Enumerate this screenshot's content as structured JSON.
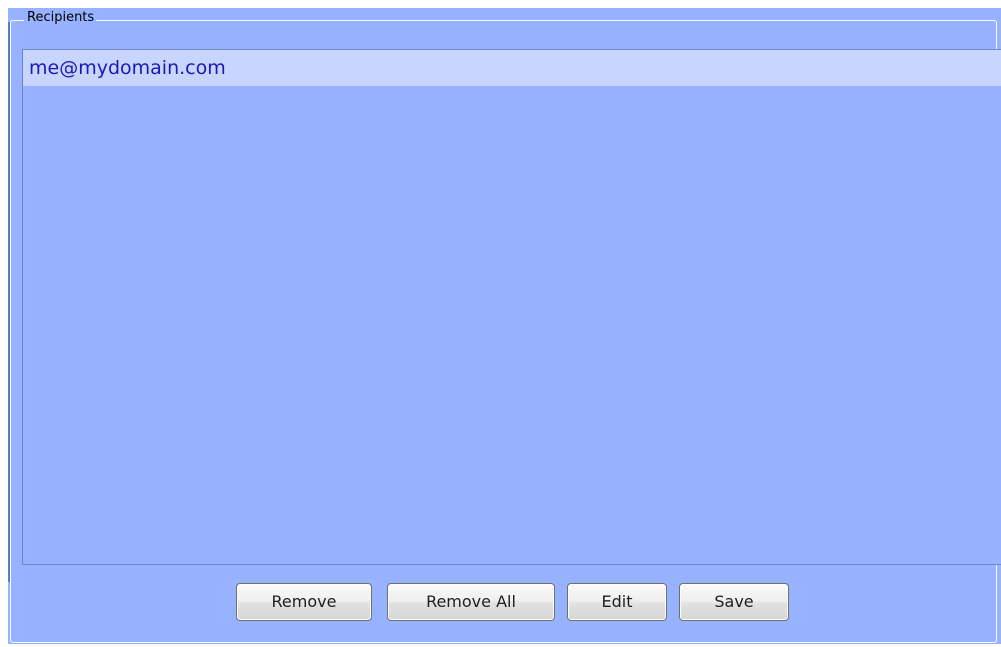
{
  "recipients_group": {
    "title": "Recipients",
    "items": [
      {
        "email": "me@mydomain.com",
        "selected": true
      }
    ]
  },
  "buttons": {
    "remove_label": "Remove",
    "remove_all_label": "Remove All",
    "edit_label": "Edit",
    "save_label": "Save"
  },
  "colors": {
    "panel_background": "#97b3ff",
    "selected_row": "#c7d5ff",
    "item_text": "#1a1ab8",
    "group_border": "#ffffff"
  }
}
